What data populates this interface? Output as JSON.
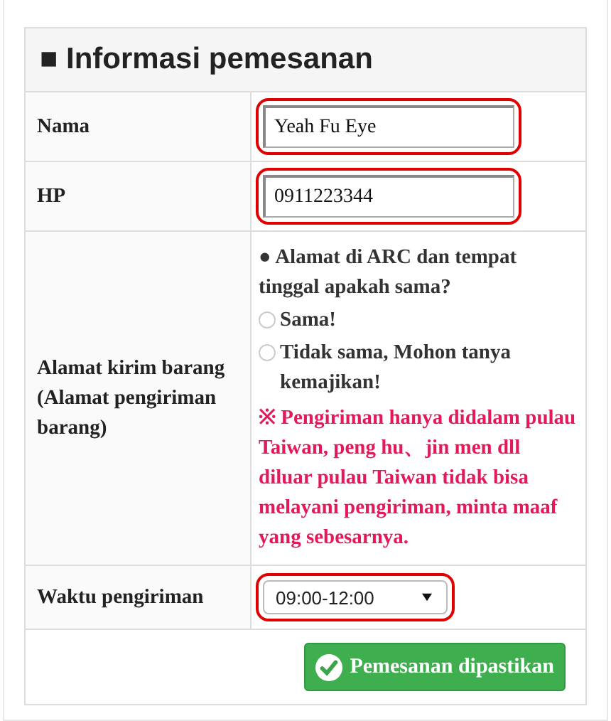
{
  "title": "■ Informasi pemesanan",
  "rows": [
    {
      "kind": "text_input",
      "label": "Nama",
      "value": "Yeah Fu Eye",
      "highlighted": true
    },
    {
      "kind": "text_input",
      "label": "HP",
      "value": "0911223344",
      "highlighted": true
    },
    {
      "kind": "radio_group",
      "label": "Alamat kirim barang (Alamat pengiriman barang)",
      "question": "● Alamat di ARC dan tempat tinggal apakah sama?",
      "options": [
        {
          "label": "Sama!",
          "selected": false
        },
        {
          "label": "Tidak sama, Mohon tanya kemajikan!",
          "selected": false
        }
      ],
      "note": "※ Pengiriman hanya didalam pulau Taiwan, peng hu、jin men dll diluar pulau Taiwan tidak bisa melayani pengiriman, minta maaf yang sebesarnya."
    },
    {
      "kind": "select",
      "label": "Waktu pengiriman",
      "value": "09:00-12:00",
      "highlighted": true
    }
  ],
  "submit_button": {
    "label": "Pemesanan dipastikan"
  }
}
